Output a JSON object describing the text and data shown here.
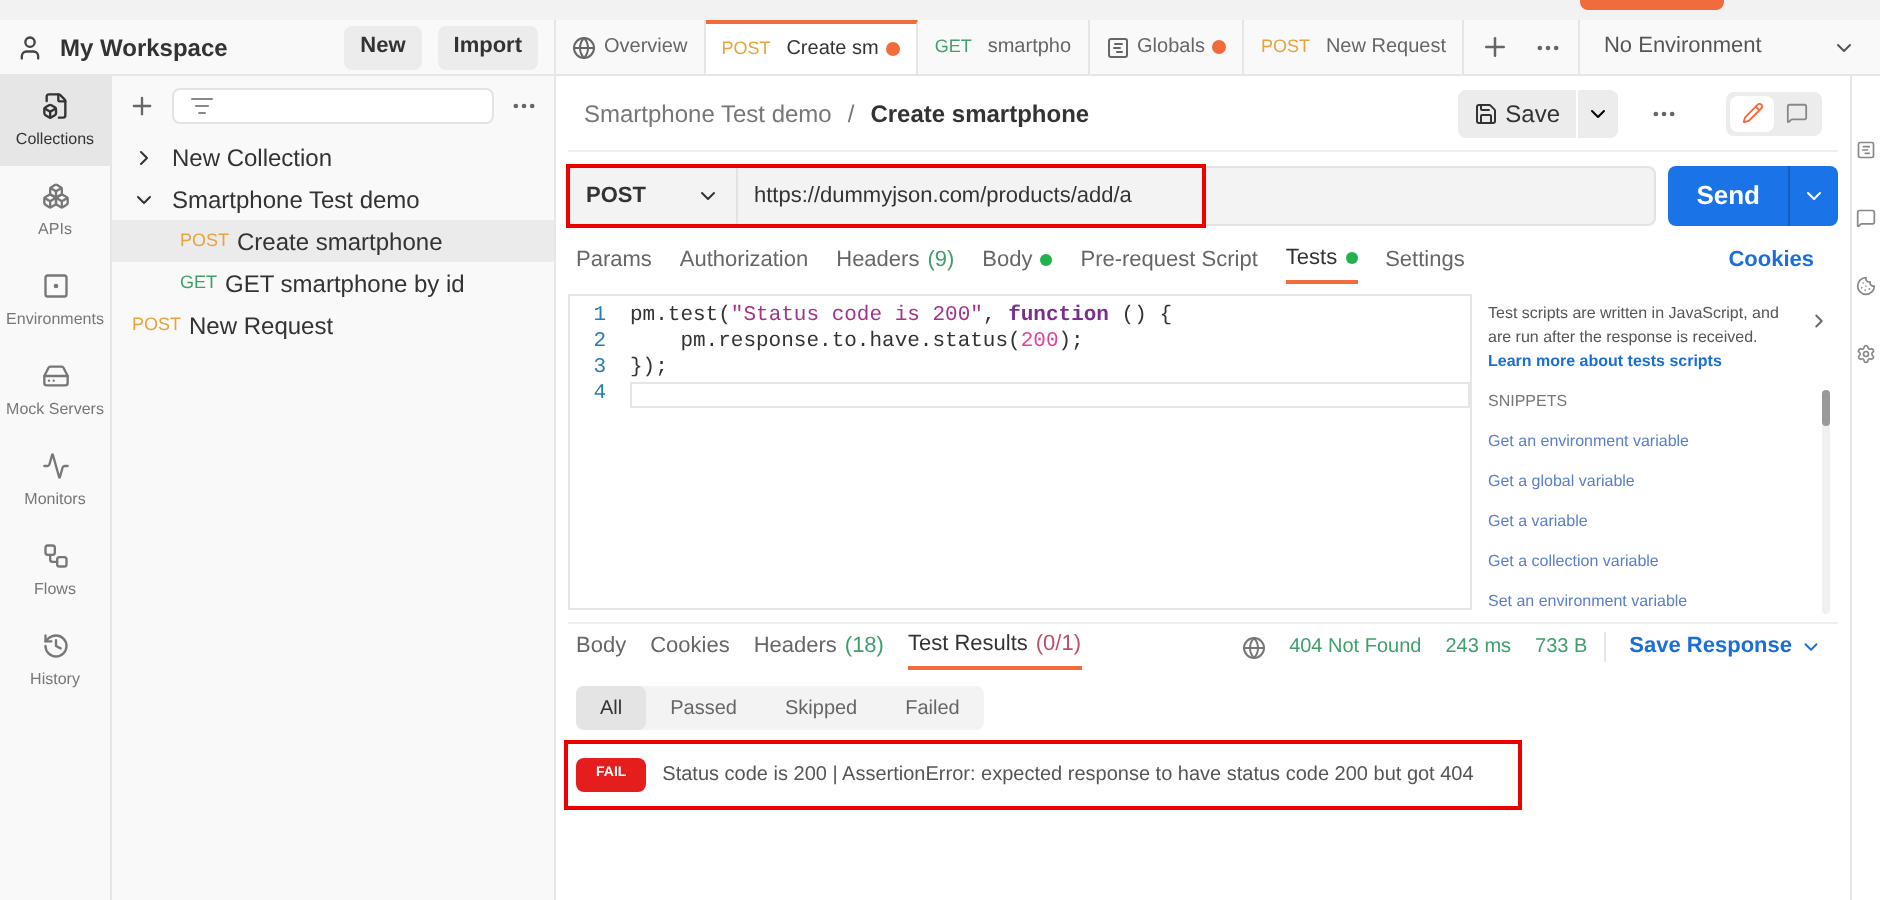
{
  "workspace": {
    "title": "My Workspace",
    "buttons": [
      "New",
      "Import"
    ]
  },
  "rail": [
    {
      "label": "Collections",
      "selected": true
    },
    {
      "label": "APIs",
      "selected": false
    },
    {
      "label": "Environments",
      "selected": false
    },
    {
      "label": "Mock Servers",
      "selected": false
    },
    {
      "label": "Monitors",
      "selected": false
    },
    {
      "label": "Flows",
      "selected": false
    },
    {
      "label": "History",
      "selected": false
    }
  ],
  "tree": [
    {
      "label": "New Collection",
      "expanded": false
    },
    {
      "label": "Smartphone Test demo",
      "expanded": true,
      "children": [
        {
          "method": "POST",
          "label": "Create smartphone",
          "selected": true
        },
        {
          "method": "GET",
          "label": "GET smartphone by id",
          "selected": false
        }
      ]
    },
    {
      "method": "POST",
      "label": "New Request",
      "selected": false
    }
  ],
  "tabs": [
    {
      "kind": "overview",
      "label": "Overview",
      "selected": false,
      "unsaved": false
    },
    {
      "kind": "request",
      "method": "POST",
      "label": "Create sm",
      "selected": true,
      "unsaved": true
    },
    {
      "kind": "request",
      "method": "GET",
      "label": "smartpho",
      "selected": false,
      "unsaved": false
    },
    {
      "kind": "globals",
      "label": "Globals",
      "selected": false,
      "unsaved": true
    },
    {
      "kind": "request",
      "method": "POST",
      "label": "New Request",
      "selected": false,
      "unsaved": false
    }
  ],
  "environment": "No Environment",
  "breadcrumb": {
    "parent": "Smartphone Test demo",
    "separator": "/",
    "current": "Create smartphone"
  },
  "save_button": "Save",
  "view_toggle": [
    {
      "kind": "edit",
      "selected": true
    },
    {
      "kind": "comments",
      "selected": false
    }
  ],
  "request": {
    "method": "POST",
    "url": "https://dummyjson.com/products/add/a",
    "highlighted": true
  },
  "send_button": "Send",
  "request_tabs": [
    {
      "label": "Params",
      "dot": false,
      "selected": false
    },
    {
      "label": "Authorization",
      "dot": false,
      "selected": false
    },
    {
      "label": "Headers",
      "count": "(9)",
      "dot": false,
      "selected": false
    },
    {
      "label": "Body",
      "dot": true,
      "selected": false
    },
    {
      "label": "Pre-request Script",
      "dot": false,
      "selected": false
    },
    {
      "label": "Tests",
      "dot": true,
      "selected": true
    },
    {
      "label": "Settings",
      "dot": false,
      "selected": false
    }
  ],
  "cookies_link": "Cookies",
  "code": [
    {
      "number": "1",
      "tokens": [
        {
          "kind": "plain",
          "text": "pm.test("
        },
        {
          "kind": "string",
          "text": "\"Status code is 200\""
        },
        {
          "kind": "plain",
          "text": ", "
        },
        {
          "kind": "keyword",
          "text": "function"
        },
        {
          "kind": "plain",
          "text": " () {"
        }
      ]
    },
    {
      "number": "2",
      "tokens": [
        {
          "kind": "plain",
          "text": "    pm.response.to.have.status("
        },
        {
          "kind": "number",
          "text": "200"
        },
        {
          "kind": "plain",
          "text": ");"
        }
      ]
    },
    {
      "number": "3",
      "tokens": [
        {
          "kind": "plain",
          "text": "});"
        }
      ]
    },
    {
      "number": "4"
    }
  ],
  "help": {
    "text": "Test scripts are written in JavaScript, and are run after the response is received.",
    "link": "Learn more about tests scripts",
    "snippets_title": "SNIPPETS",
    "snippets": [
      "Get an environment variable",
      "Get a global variable",
      "Get a variable",
      "Get a collection variable",
      "Set an environment variable"
    ]
  },
  "response_tabs": [
    {
      "label": "Body",
      "selected": false
    },
    {
      "label": "Cookies",
      "selected": false
    },
    {
      "label": "Headers",
      "count": "(18)",
      "selected": false
    },
    {
      "label": "Test Results",
      "count": "(0/1)",
      "selected": true
    }
  ],
  "status": {
    "code": "404 Not Found",
    "time": "243 ms",
    "size": "733 B"
  },
  "save_response": "Save Response",
  "filters": [
    {
      "label": "All",
      "selected": true
    },
    {
      "label": "Passed",
      "selected": false
    },
    {
      "label": "Skipped",
      "selected": false
    },
    {
      "label": "Failed",
      "selected": false
    }
  ],
  "results": [
    {
      "status": "FAIL",
      "message": "Status code is 200 | AssertionError: expected response to have status code 200 but got 404",
      "highlighted": true
    }
  ]
}
